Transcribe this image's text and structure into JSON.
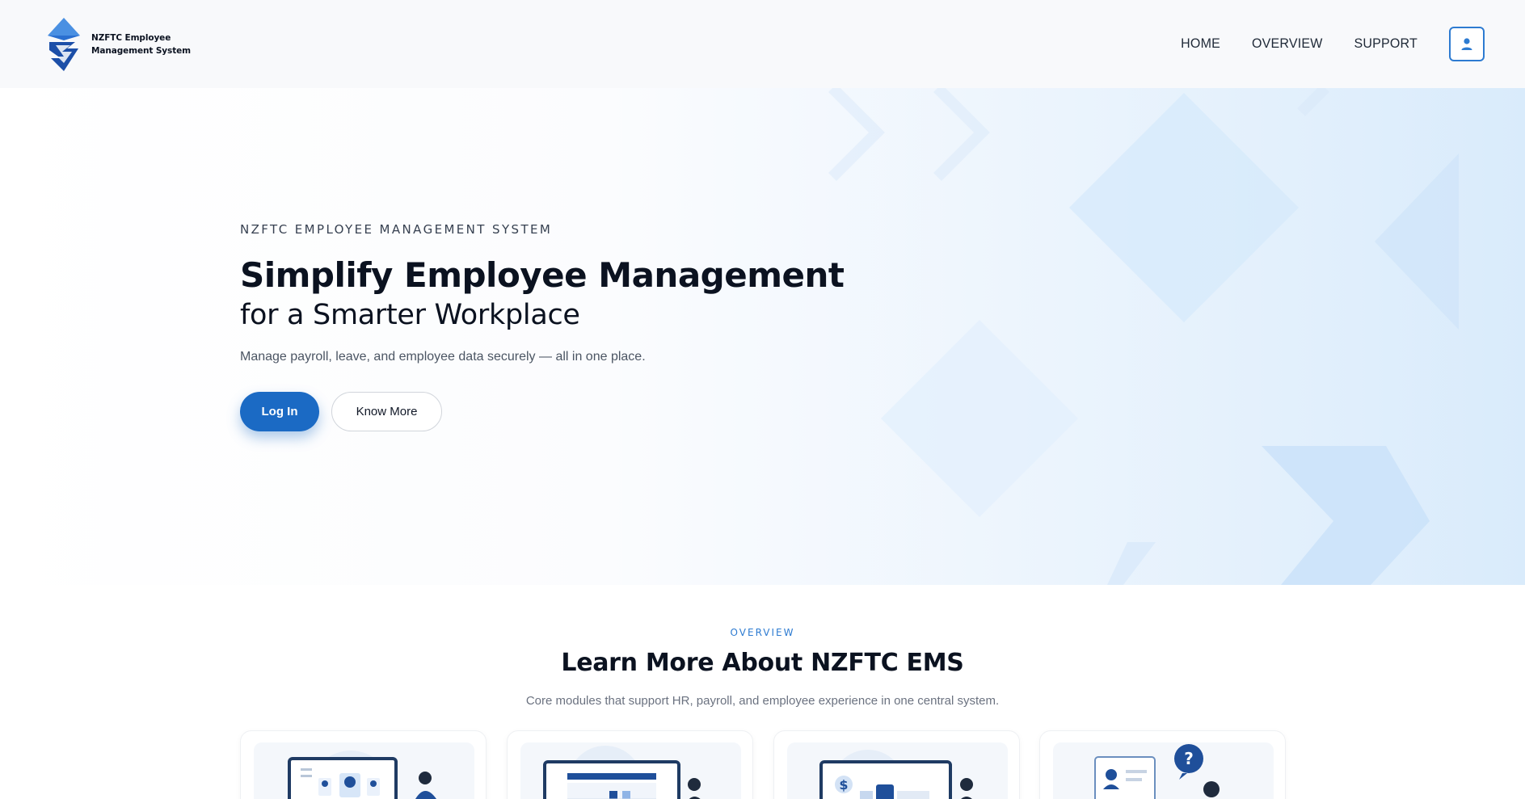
{
  "header": {
    "brand": {
      "line1": "NZFTC Employee",
      "line2": "Management System"
    },
    "nav": [
      "HOME",
      "OVERVIEW",
      "SUPPORT"
    ],
    "profile_icon": "user-icon"
  },
  "hero": {
    "eyebrow": "NZFTC EMPLOYEE MANAGEMENT SYSTEM",
    "title": "Simplify Employee Management",
    "subtitle": "for a Smarter Workplace",
    "description": "Manage payroll, leave, and employee data securely — all in one place.",
    "primary_button": "Log In",
    "secondary_button": "Know More"
  },
  "overview": {
    "eyebrow": "OVERVIEW",
    "title": "Learn More About NZFTC EMS",
    "description": "Core modules that support HR, payroll, and employee experience in one central system.",
    "cards": [
      {
        "icon": "employee-directory-illustration"
      },
      {
        "icon": "calendar-dashboard-illustration"
      },
      {
        "icon": "payroll-illustration"
      },
      {
        "icon": "support-help-illustration"
      }
    ]
  },
  "colors": {
    "accent": "#1b6ac4",
    "accent_light": "#2d7bd1",
    "header_bg": "#f8f9fb",
    "hero_shape": "#d7e9fb",
    "text_dark": "#0b1220"
  }
}
